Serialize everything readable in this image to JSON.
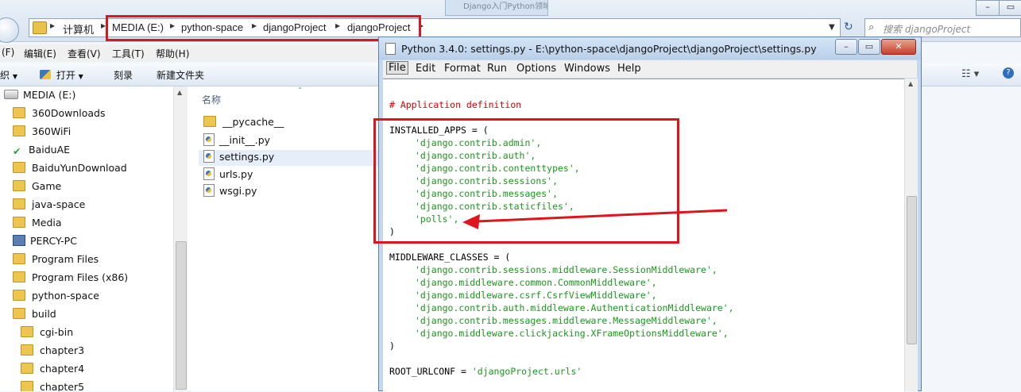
{
  "explorer": {
    "browser_tab_text": "Django入门Python领域",
    "breadcrumbs": [
      "计算机",
      "MEDIA (E:)",
      "python-space",
      "djangoProject",
      "djangoProject"
    ],
    "search_placeholder": "搜索 djangoProject",
    "menu": [
      "(F)",
      "编辑(E)",
      "查看(V)",
      "工具(T)",
      "帮助(H)"
    ],
    "toolbar": {
      "organize_fragment": "织",
      "open_label": "打开",
      "burn_label": "刻录",
      "new_folder_label": "新建文件夹"
    },
    "nav_items": [
      {
        "label": "MEDIA (E:)",
        "icon": "drive-icon"
      },
      {
        "label": "360Downloads",
        "icon": "folder-icon"
      },
      {
        "label": "360WiFi",
        "icon": "folder-icon"
      },
      {
        "label": "BaiduAE",
        "icon": "green-check-icon"
      },
      {
        "label": "BaiduYunDownload",
        "icon": "folder-icon"
      },
      {
        "label": "Game",
        "icon": "folder-icon"
      },
      {
        "label": "java-space",
        "icon": "folder-icon"
      },
      {
        "label": "Media",
        "icon": "folder-icon"
      },
      {
        "label": "PERCY-PC",
        "icon": "computer-icon"
      },
      {
        "label": "Program Files",
        "icon": "folder-icon"
      },
      {
        "label": "Program Files (x86)",
        "icon": "folder-icon"
      },
      {
        "label": "python-space",
        "icon": "folder-icon"
      },
      {
        "label": "build",
        "icon": "folder-icon"
      },
      {
        "label": "cgi-bin",
        "icon": "folder-icon"
      },
      {
        "label": "chapter3",
        "icon": "folder-icon"
      },
      {
        "label": "chapter4",
        "icon": "folder-icon"
      },
      {
        "label": "chapter5",
        "icon": "folder-icon"
      }
    ],
    "column_header": "名称",
    "files": [
      {
        "name": "__pycache__",
        "type": "folder",
        "selected": false
      },
      {
        "name": "__init__.py",
        "type": "python-file",
        "selected": false
      },
      {
        "name": "settings.py",
        "type": "python-file",
        "selected": true
      },
      {
        "name": "urls.py",
        "type": "python-file",
        "selected": false
      },
      {
        "name": "wsgi.py",
        "type": "python-file",
        "selected": false
      }
    ]
  },
  "idle": {
    "title": "Python 3.4.0: settings.py - E:\\python-space\\djangoProject\\djangoProject\\settings.py",
    "menu": [
      "File",
      "Edit",
      "Format",
      "Run",
      "Options",
      "Windows",
      "Help"
    ],
    "active_menu": "File",
    "code": {
      "comment": "# Application definition",
      "installed_apps_open": "INSTALLED_APPS = (",
      "installed_apps": [
        "'django.contrib.admin',",
        "'django.contrib.auth',",
        "'django.contrib.contenttypes',",
        "'django.contrib.sessions',",
        "'django.contrib.messages',",
        "'django.contrib.staticfiles',",
        "'polls',"
      ],
      "close_paren": ")",
      "middleware_open": "MIDDLEWARE_CLASSES = (",
      "middleware": [
        "'django.contrib.sessions.middleware.SessionMiddleware',",
        "'django.middleware.common.CommonMiddleware',",
        "'django.middleware.csrf.CsrfViewMiddleware',",
        "'django.contrib.auth.middleware.AuthenticationMiddleware',",
        "'django.contrib.messages.middleware.MessageMiddleware',",
        "'django.middleware.clickjacking.XFrameOptionsMiddleware',"
      ],
      "root_urlconf_key": "ROOT_URLCONF = ",
      "root_urlconf_value": "'djangoProject.urls'"
    }
  },
  "colors": {
    "annotation_red": "#e0141c",
    "string_green": "#1a9a1a",
    "comment_red": "#dd0000"
  }
}
